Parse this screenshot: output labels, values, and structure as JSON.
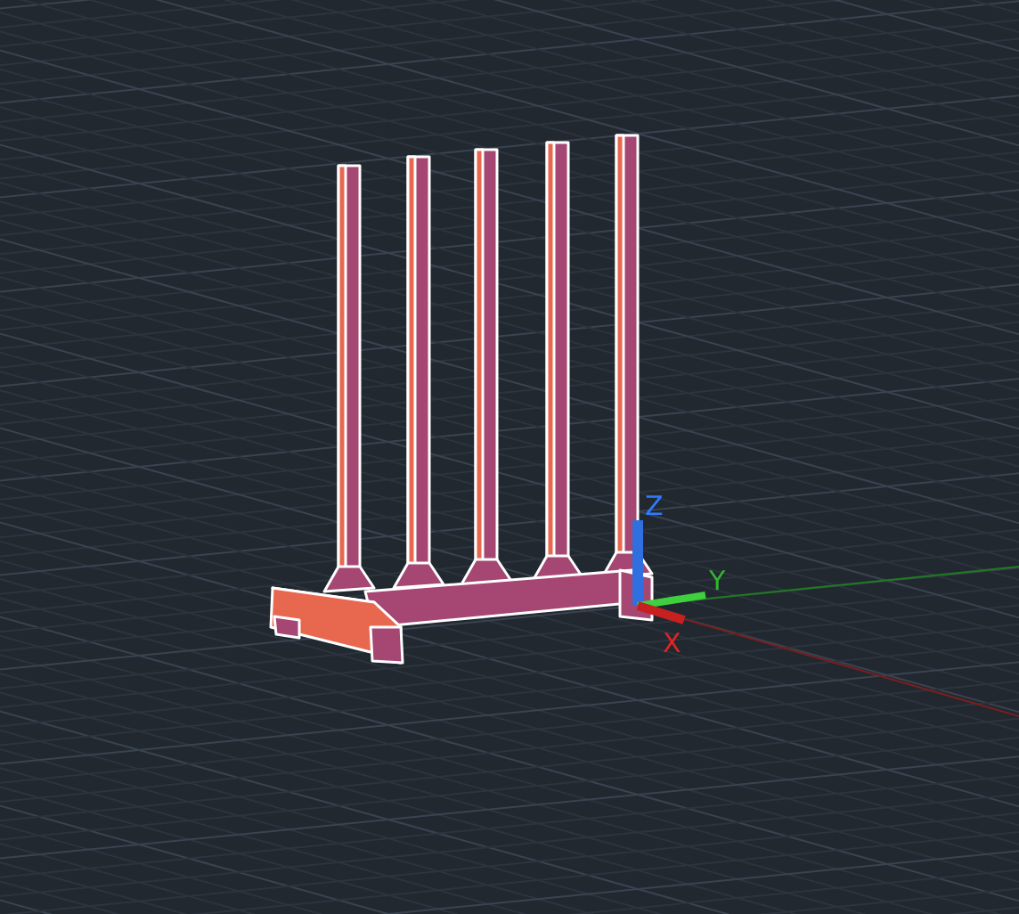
{
  "viewport": {
    "axis_labels": [
      {
        "text": "Z",
        "color": "#2f7bff"
      },
      {
        "text": "Y",
        "color": "#2fb82f"
      },
      {
        "text": "X",
        "color": "#e02424"
      }
    ]
  }
}
